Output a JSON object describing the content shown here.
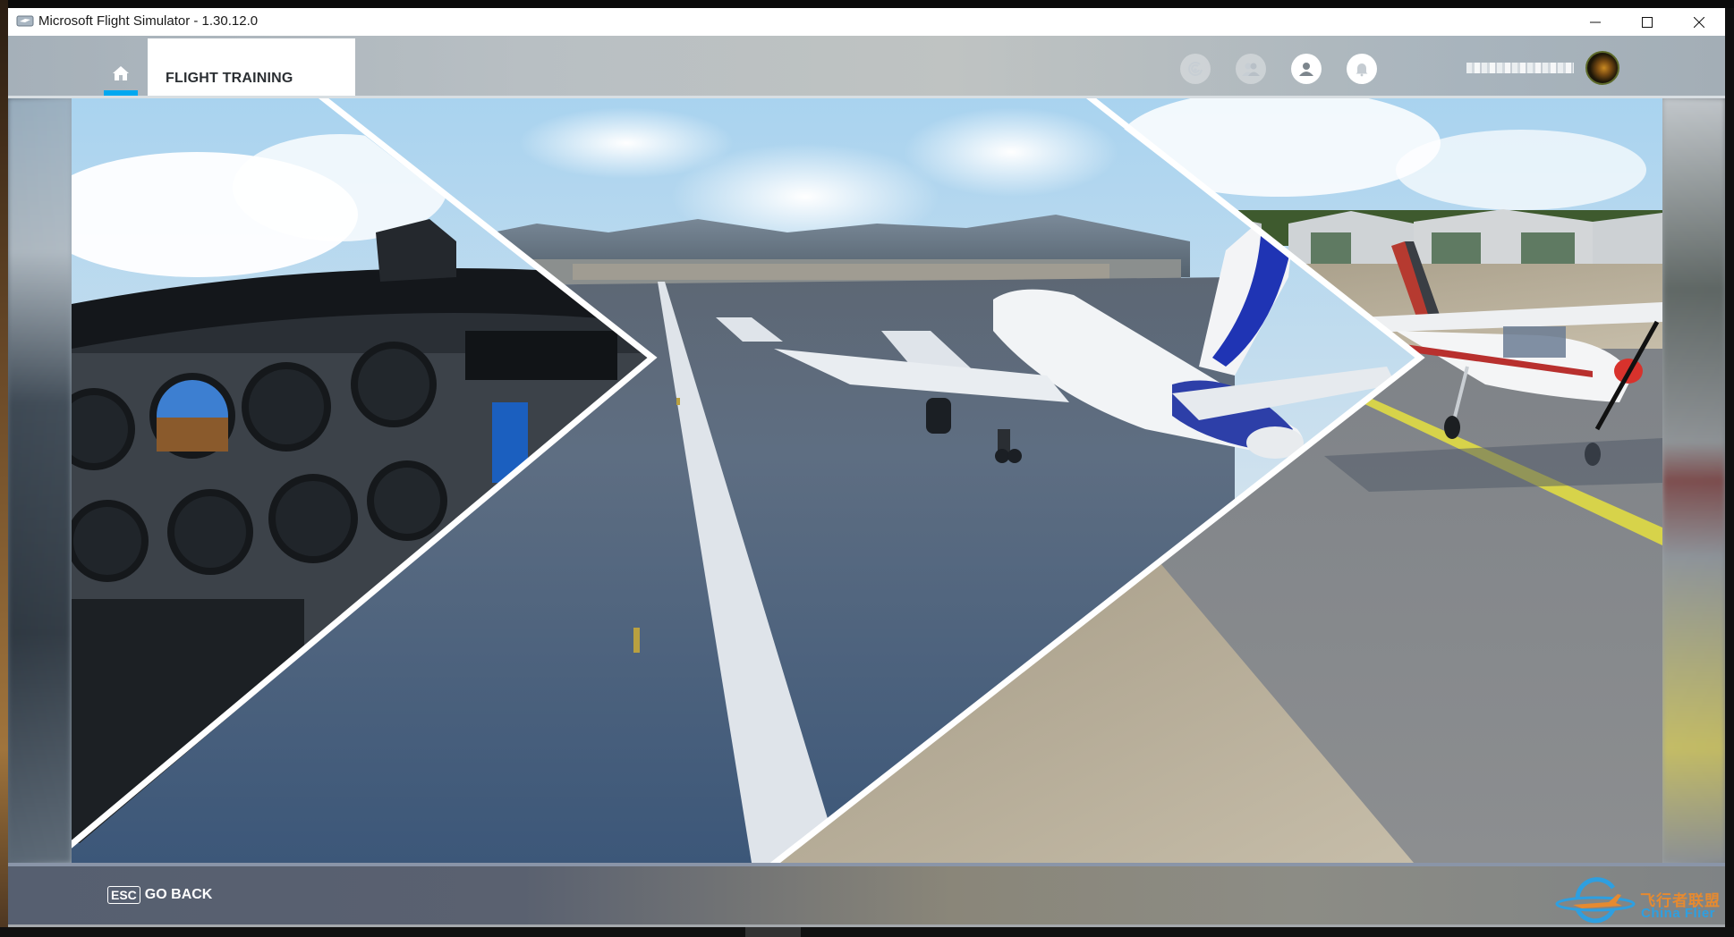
{
  "window": {
    "title": "Microsoft Flight Simulator - 1.30.12.0",
    "controls": {
      "minimize": "minimize",
      "maximize": "maximize",
      "close": "close"
    }
  },
  "header": {
    "home_icon": "home-icon",
    "active_tab": "home",
    "tab_label": "FLIGHT TRAINING",
    "icons": [
      {
        "name": "activity-icon",
        "state": "disabled"
      },
      {
        "name": "friends-icon",
        "state": "disabled"
      },
      {
        "name": "profile-icon",
        "state": "enabled"
      },
      {
        "name": "notifications-icon",
        "state": "enabled"
      }
    ],
    "username": "(obscured)"
  },
  "scene": {
    "panels": [
      {
        "name": "cockpit-panel",
        "subject": "Cessna 152 instrument panel"
      },
      {
        "name": "runway-panel",
        "subject": "Airbus A320neo taking off"
      },
      {
        "name": "apron-panel",
        "subject": "Cessna 152 on taxiway"
      }
    ]
  },
  "footer": {
    "key_hint": "ESC",
    "back_label": "GO BACK"
  },
  "watermark": {
    "cn": "飞行者联盟",
    "en": "China Flier"
  },
  "colors": {
    "accent": "#00a8f0",
    "tab_bg": "#ffffff",
    "tab_text": "#2b2f33",
    "footer_text": "#ffffff"
  }
}
